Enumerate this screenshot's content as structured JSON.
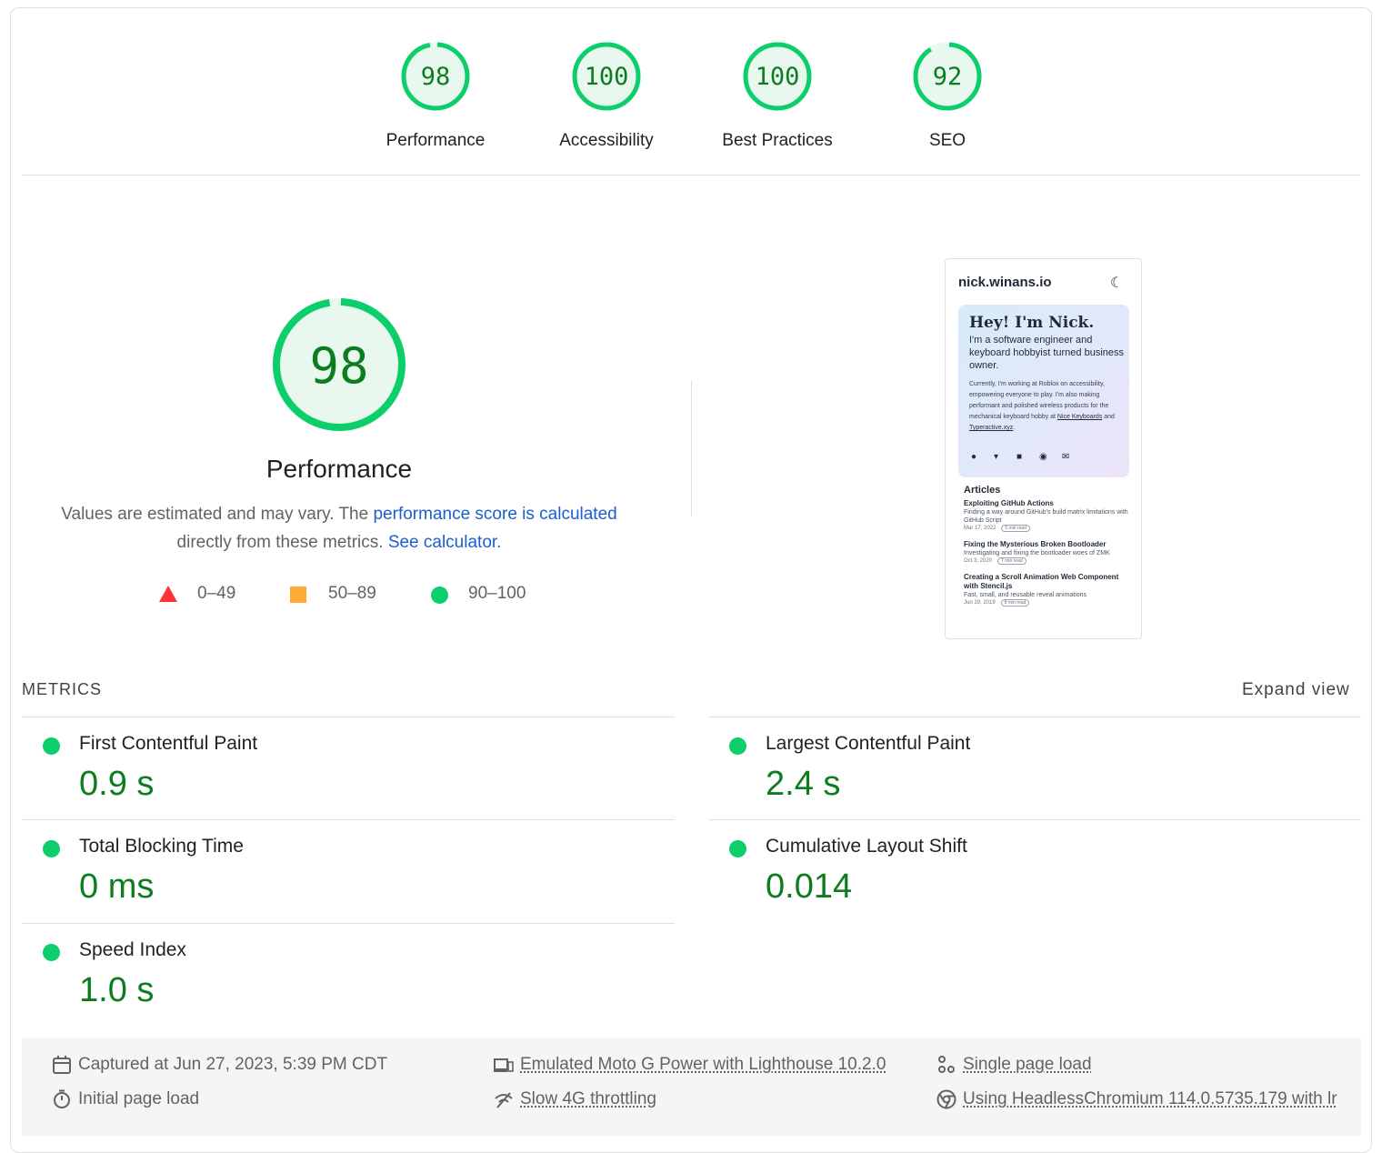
{
  "colors": {
    "pass": "#0cce6b",
    "pass_text": "#0c7d1f",
    "average": "#ffaa33",
    "fail": "#ff3333",
    "link": "#1a5fd0"
  },
  "gauges": [
    {
      "label": "Performance",
      "score": "98",
      "value": 98
    },
    {
      "label": "Accessibility",
      "score": "100",
      "value": 100
    },
    {
      "label": "Best Practices",
      "score": "100",
      "value": 100
    },
    {
      "label": "SEO",
      "score": "92",
      "value": 92
    }
  ],
  "performance": {
    "score": "98",
    "value": 98,
    "title": "Performance",
    "desc_prefix": "Values are estimated and may vary. The ",
    "desc_link": "performance score is calculated",
    "desc_mid": " directly from these metrics. ",
    "desc_link2": "See calculator."
  },
  "legend": {
    "fail": "0–49",
    "average": "50–89",
    "pass": "90–100"
  },
  "screenshot": {
    "site": "nick.winans.io",
    "moon_icon": "☾",
    "hero_title": "Hey! I'm Nick.",
    "hero_sub": "I'm a software engineer and keyboard hobbyist turned business owner.",
    "hero_p1": "Currently, I'm working at Roblox on accessibility, empowering everyone to play. I'm also making performant and polished wireless products for the mechanical keyboard hobby at ",
    "hero_link1": "Nice Keyboards",
    "hero_and": " and ",
    "hero_link2": "Typeractive.xyz",
    "hero_end": ".",
    "social_icons": [
      "github-icon",
      "twitter-icon",
      "linkedin-icon",
      "discord-icon",
      "mail-icon"
    ],
    "articles_title": "Articles",
    "articles": [
      {
        "title": "Exploiting GitHub Actions",
        "desc": "Finding a way around GitHub's build matrix limitations with GitHub Script",
        "date": "Mar 17, 2022",
        "read": "5 min read"
      },
      {
        "title": "Fixing the Mysterious Broken Bootloader",
        "desc": "Investigating and fixing the bootloader woes of ZMK",
        "date": "Oct 3, 2020",
        "read": "7 min read"
      },
      {
        "title": "Creating a Scroll Animation Web Component with Stencil.js",
        "desc": "Fast, small, and reusable reveal animations",
        "date": "Jun 19, 2019",
        "read": "8 min read"
      }
    ]
  },
  "metrics": {
    "header": "METRICS",
    "expand": "Expand view",
    "items": [
      {
        "name": "First Contentful Paint",
        "value": "0.9 s"
      },
      {
        "name": "Largest Contentful Paint",
        "value": "2.4 s"
      },
      {
        "name": "Total Blocking Time",
        "value": "0 ms"
      },
      {
        "name": "Cumulative Layout Shift",
        "value": "0.014"
      },
      {
        "name": "Speed Index",
        "value": "1.0 s"
      }
    ]
  },
  "footer": {
    "captured": "Captured at Jun 27, 2023, 5:39 PM CDT",
    "initial": "Initial page load",
    "device": "Emulated Moto G Power with Lighthouse 10.2.0",
    "throttling": "Slow 4G throttling",
    "single": "Single page load",
    "browser": "Using HeadlessChromium 114.0.5735.179 with lr"
  }
}
